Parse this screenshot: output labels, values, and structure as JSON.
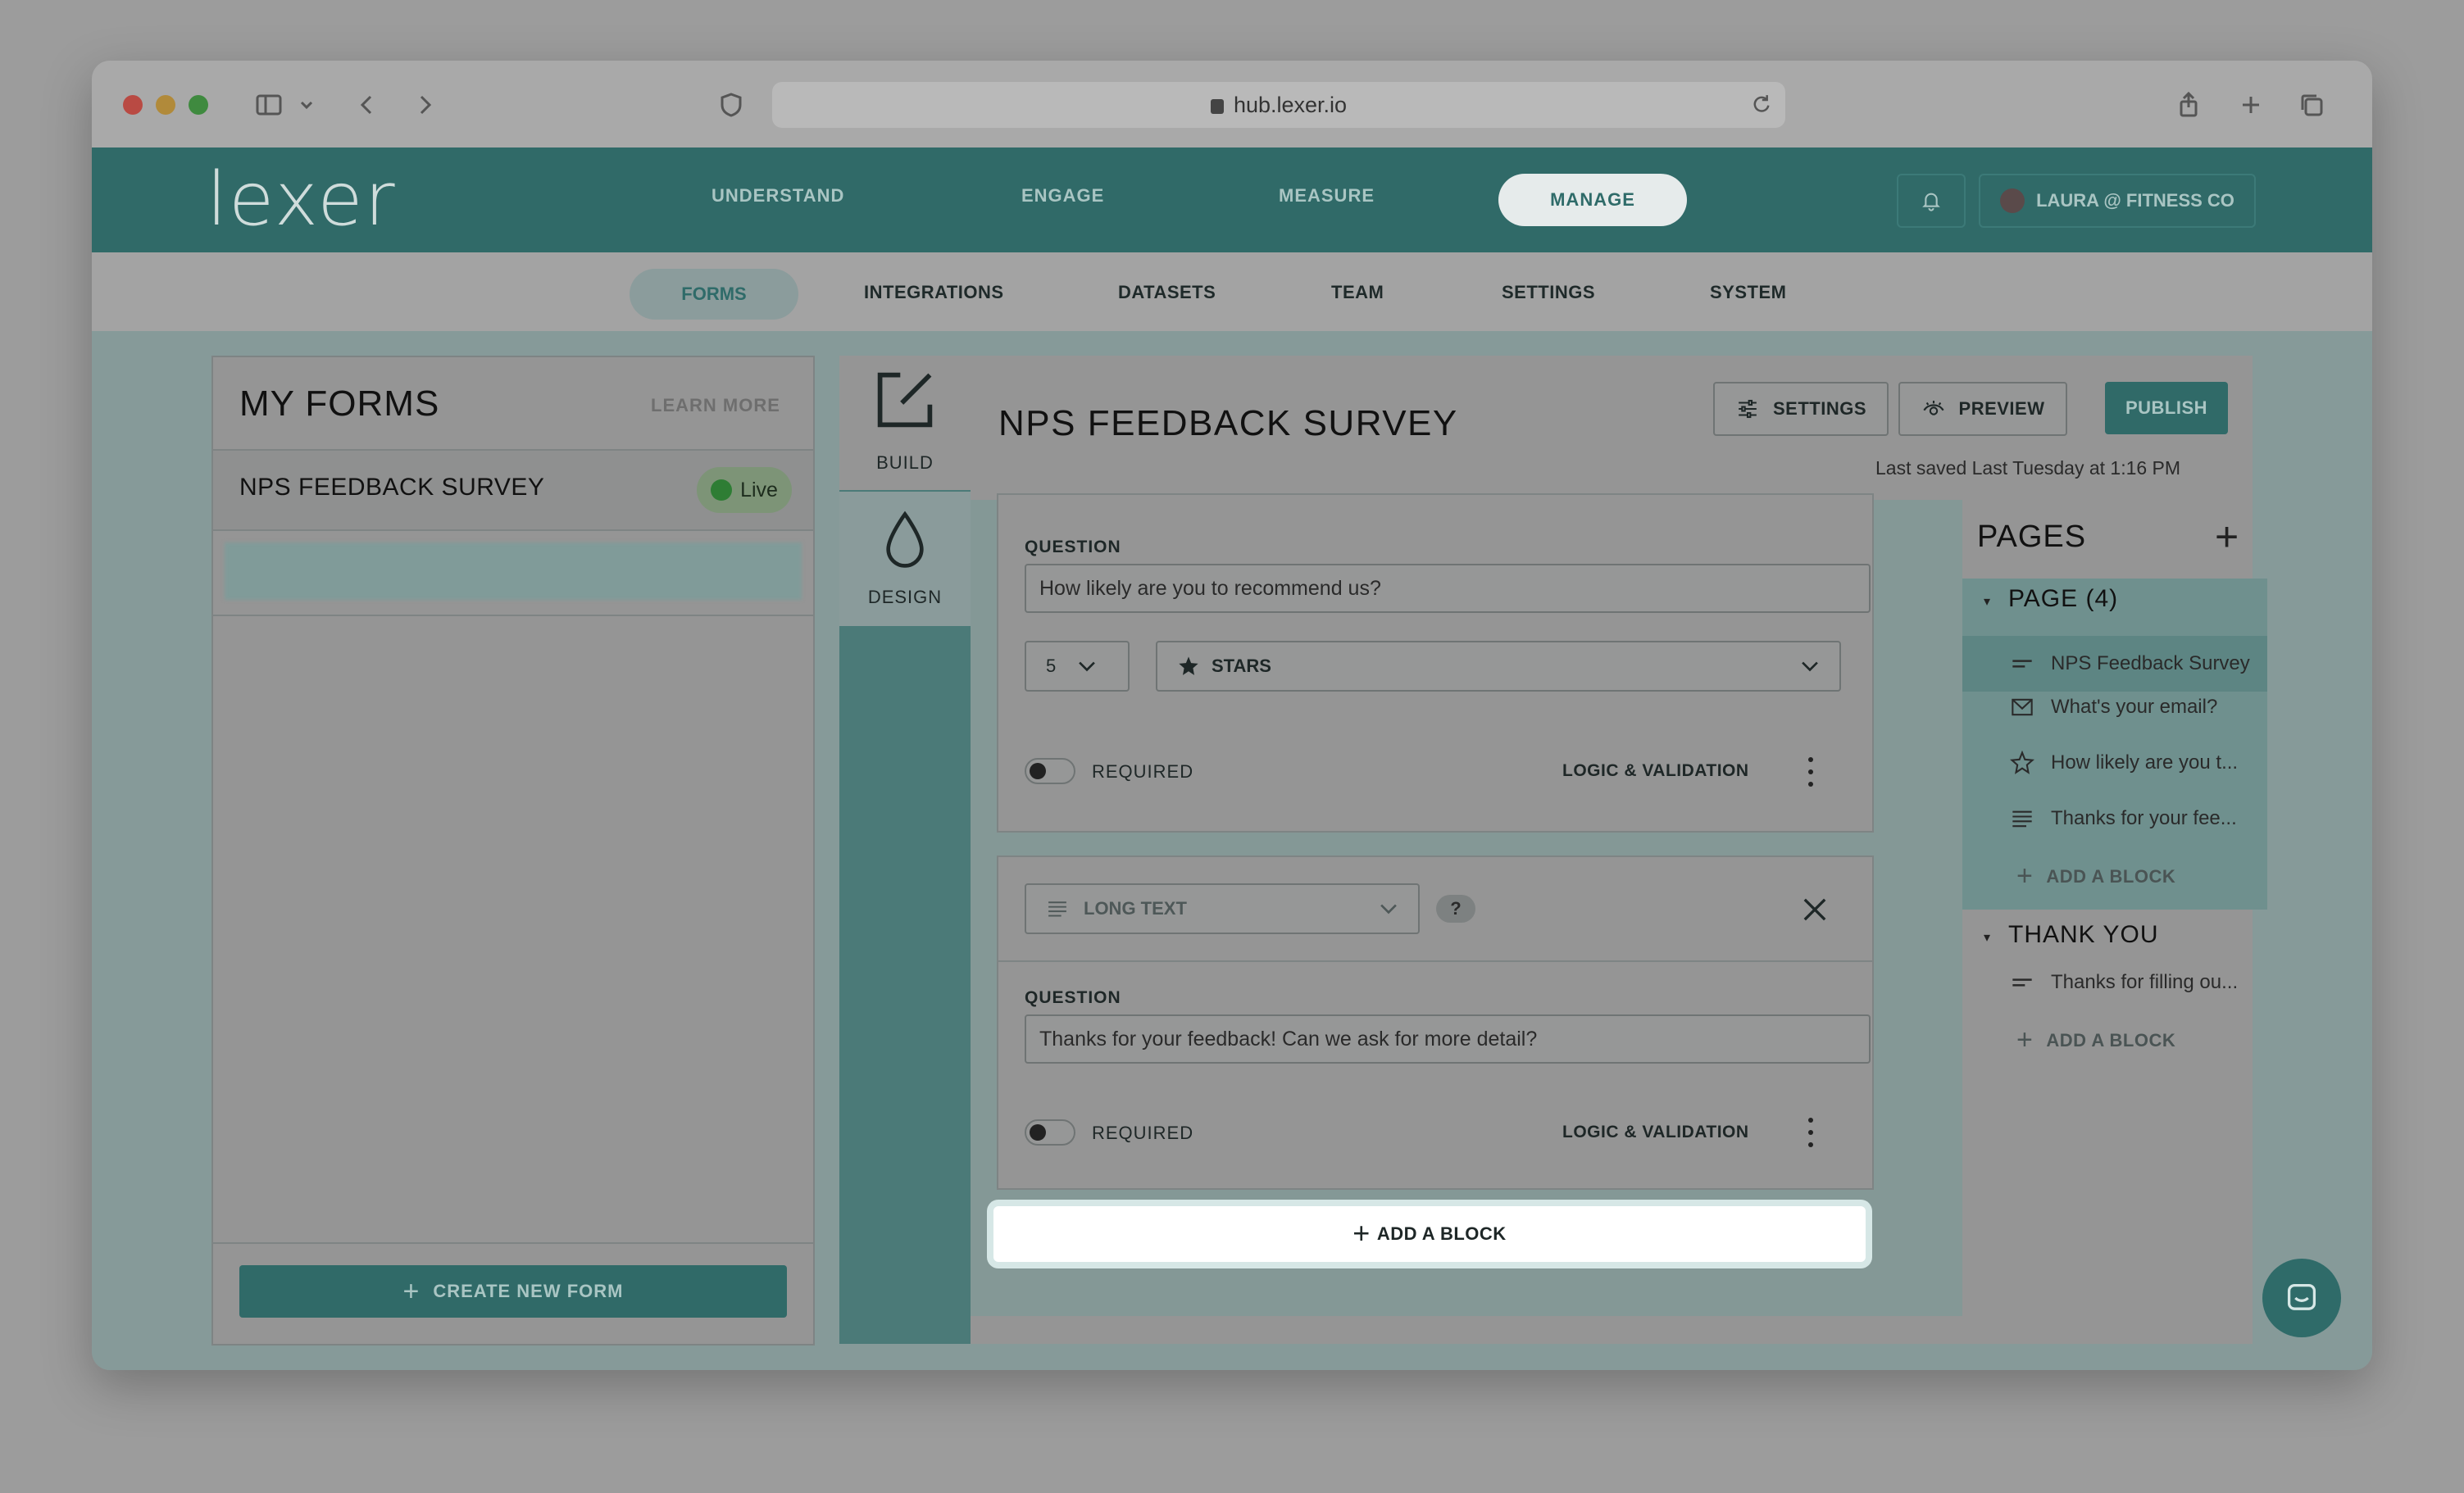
{
  "browser": {
    "url": "hub.lexer.io"
  },
  "app": {
    "logo": "lexer",
    "nav": {
      "understand": "UNDERSTAND",
      "engage": "ENGAGE",
      "measure": "MEASURE",
      "manage": "MANAGE"
    },
    "user": "LAURA @ FITNESS CO",
    "subnav": {
      "forms": "FORMS",
      "integrations": "INTEGRATIONS",
      "datasets": "DATASETS",
      "team": "TEAM",
      "settings": "SETTINGS",
      "system": "SYSTEM"
    }
  },
  "sidebar": {
    "title": "MY FORMS",
    "learn_more": "LEARN MORE",
    "forms": [
      {
        "name": "NPS FEEDBACK SURVEY",
        "status": "Live"
      }
    ],
    "create_button": "CREATE NEW FORM"
  },
  "rail": {
    "build": "BUILD",
    "design": "DESIGN"
  },
  "editor": {
    "title": "NPS FEEDBACK SURVEY",
    "settings_button": "SETTINGS",
    "preview_button": "PREVIEW",
    "publish_button": "PUBLISH",
    "last_saved": "Last saved Last Tuesday at 1:16 PM",
    "blocks": [
      {
        "question_label": "QUESTION",
        "question_value": "How likely are you to recommend us?",
        "scale_value": "5",
        "icon_value": "STARS",
        "required_label": "REQUIRED",
        "logic_label": "LOGIC & VALIDATION"
      },
      {
        "type_label": "LONG TEXT",
        "help": "?",
        "question_label": "QUESTION",
        "question_value": "Thanks for your feedback! Can we ask for more detail?",
        "required_label": "REQUIRED",
        "logic_label": "LOGIC & VALIDATION"
      }
    ],
    "add_block": "ADD A BLOCK"
  },
  "pages": {
    "title": "PAGES",
    "groups": [
      {
        "name": "PAGE (4)",
        "items": [
          {
            "label": "NPS Feedback Survey",
            "icon": "short-text-icon"
          },
          {
            "label": "What's your email?",
            "icon": "mail-icon"
          },
          {
            "label": "How likely are you t...",
            "icon": "star-icon"
          },
          {
            "label": "Thanks for your fee...",
            "icon": "long-text-icon"
          }
        ],
        "add_block": "ADD A BLOCK"
      },
      {
        "name": "THANK YOU",
        "items": [
          {
            "label": "Thanks for filling ou...",
            "icon": "short-text-icon"
          }
        ],
        "add_block": "ADD A BLOCK"
      }
    ]
  }
}
